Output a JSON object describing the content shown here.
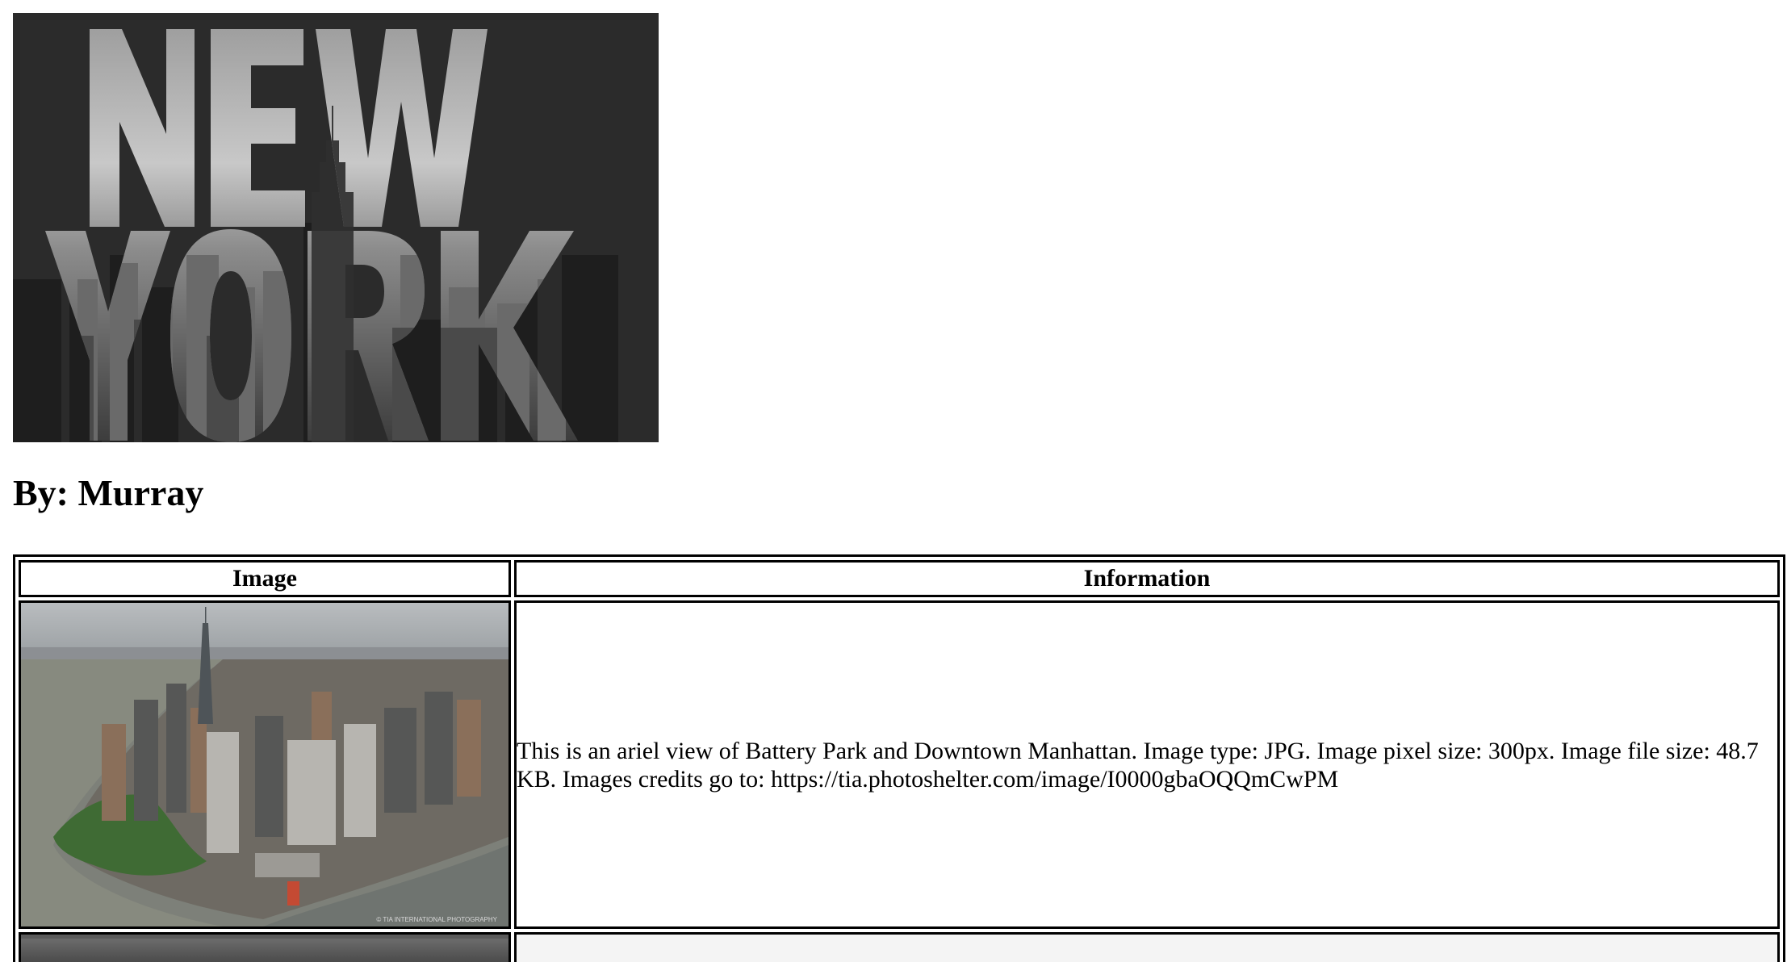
{
  "banner": {
    "alt": "New York banner",
    "lettering": "NEW YORK"
  },
  "byline": "By: Murray",
  "table": {
    "headers": {
      "image": "Image",
      "information": "Information"
    },
    "rows": [
      {
        "image_alt": "Aerial view of Battery Park and Downtown Manhattan",
        "watermark": "© TIA INTERNATIONAL PHOTOGRAPHY",
        "information": "This is an ariel view of Battery Park and Downtown Manhattan. Image type: JPG. Image pixel size: 300px. Image file size: 48.7 KB. Images credits go to: https://tia.photoshelter.com/image/I0000gbaOQQmCwPM"
      },
      {
        "image_alt": "",
        "information": ""
      }
    ]
  }
}
